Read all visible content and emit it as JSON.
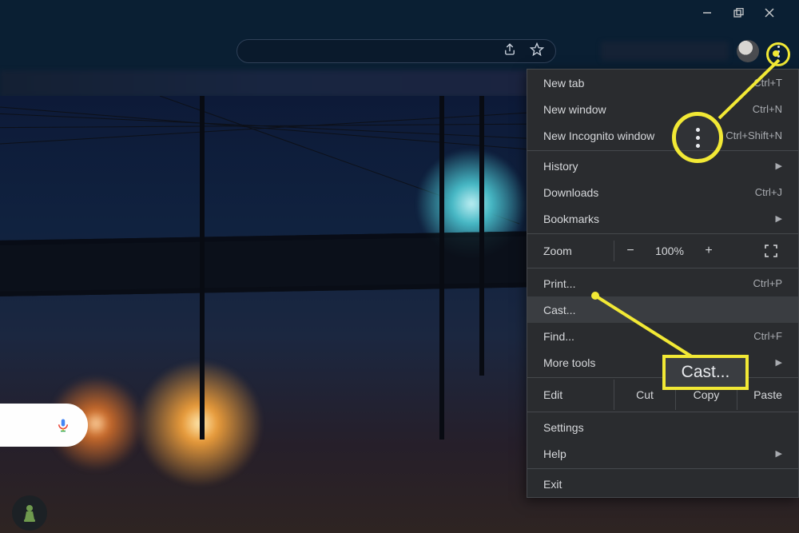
{
  "window_controls": {
    "minimize": "—",
    "maximize": "❐",
    "close": "✕"
  },
  "toolbar": {
    "share_icon": "share-icon",
    "star_icon": "star-icon",
    "kebab_icon": "kebab-icon"
  },
  "menu": {
    "new_tab": {
      "label": "New tab",
      "shortcut": "Ctrl+T"
    },
    "new_window": {
      "label": "New window",
      "shortcut": "Ctrl+N"
    },
    "new_incognito": {
      "label": "New Incognito window",
      "shortcut": "Ctrl+Shift+N"
    },
    "history": {
      "label": "History",
      "has_submenu": true
    },
    "downloads": {
      "label": "Downloads",
      "shortcut": "Ctrl+J"
    },
    "bookmarks": {
      "label": "Bookmarks",
      "has_submenu": true
    },
    "zoom": {
      "label": "Zoom",
      "minus": "−",
      "value": "100%",
      "plus": "+"
    },
    "print": {
      "label": "Print...",
      "shortcut": "Ctrl+P"
    },
    "cast": {
      "label": "Cast..."
    },
    "find": {
      "label": "Find...",
      "shortcut": "Ctrl+F"
    },
    "more_tools": {
      "label": "More tools",
      "has_submenu": true
    },
    "edit": {
      "label": "Edit",
      "cut": "Cut",
      "copy": "Copy",
      "paste": "Paste"
    },
    "settings": {
      "label": "Settings"
    },
    "help": {
      "label": "Help",
      "has_submenu": true
    },
    "exit": {
      "label": "Exit"
    }
  },
  "callout": {
    "label": "Cast..."
  }
}
